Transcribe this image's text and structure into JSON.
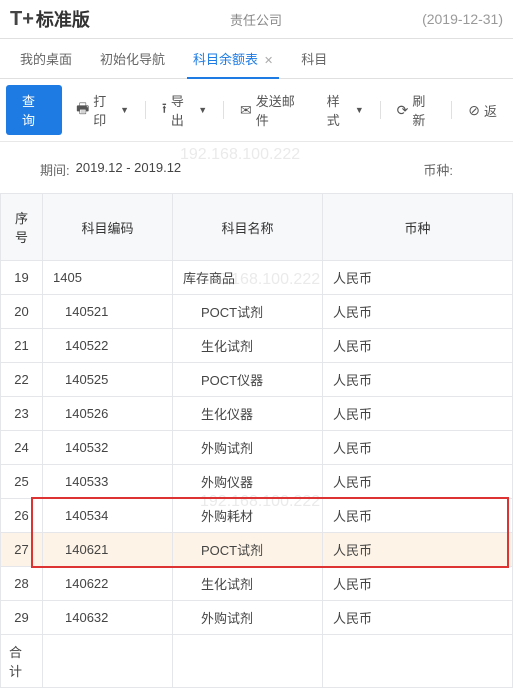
{
  "header": {
    "logo_prefix": "T+",
    "logo_text": "标准版",
    "company_suffix": "责任公司",
    "date_paren": "(2019-12-31)"
  },
  "tabs": [
    {
      "label": "我的桌面",
      "active": false,
      "closable": false
    },
    {
      "label": "初始化导航",
      "active": false,
      "closable": false
    },
    {
      "label": "科目余额表",
      "active": true,
      "closable": true
    },
    {
      "label": "科目",
      "active": false,
      "closable": false
    }
  ],
  "toolbar": {
    "query": "查询",
    "print": "打印",
    "export": "导出",
    "sendmail": "发送邮件",
    "style": "样式",
    "refresh": "刷新",
    "back": "返"
  },
  "info": {
    "period_label": "期间:",
    "period_value": "2019.12 - 2019.12",
    "currency_label": "币种:"
  },
  "columns": {
    "seq": "序号",
    "code": "科目编码",
    "name": "科目名称",
    "currency": "币种"
  },
  "rows": [
    {
      "seq": "19",
      "code": "1405",
      "name": "库存商品",
      "currency": "人民币",
      "top": true
    },
    {
      "seq": "20",
      "code": "140521",
      "name": "POCT试剂",
      "currency": "人民币"
    },
    {
      "seq": "21",
      "code": "140522",
      "name": "生化试剂",
      "currency": "人民币"
    },
    {
      "seq": "22",
      "code": "140525",
      "name": "POCT仪器",
      "currency": "人民币"
    },
    {
      "seq": "23",
      "code": "140526",
      "name": "生化仪器",
      "currency": "人民币"
    },
    {
      "seq": "24",
      "code": "140532",
      "name": "外购试剂",
      "currency": "人民币"
    },
    {
      "seq": "25",
      "code": "140533",
      "name": "外购仪器",
      "currency": "人民币"
    },
    {
      "seq": "26",
      "code": "140534",
      "name": "外购耗材",
      "currency": "人民币"
    },
    {
      "seq": "27",
      "code": "140621",
      "name": "POCT试剂",
      "currency": "人民币",
      "selected": true
    },
    {
      "seq": "28",
      "code": "140622",
      "name": "生化试剂",
      "currency": "人民币"
    },
    {
      "seq": "29",
      "code": "140632",
      "name": "外购试剂",
      "currency": "人民币"
    }
  ],
  "footer": {
    "total": "合计"
  }
}
